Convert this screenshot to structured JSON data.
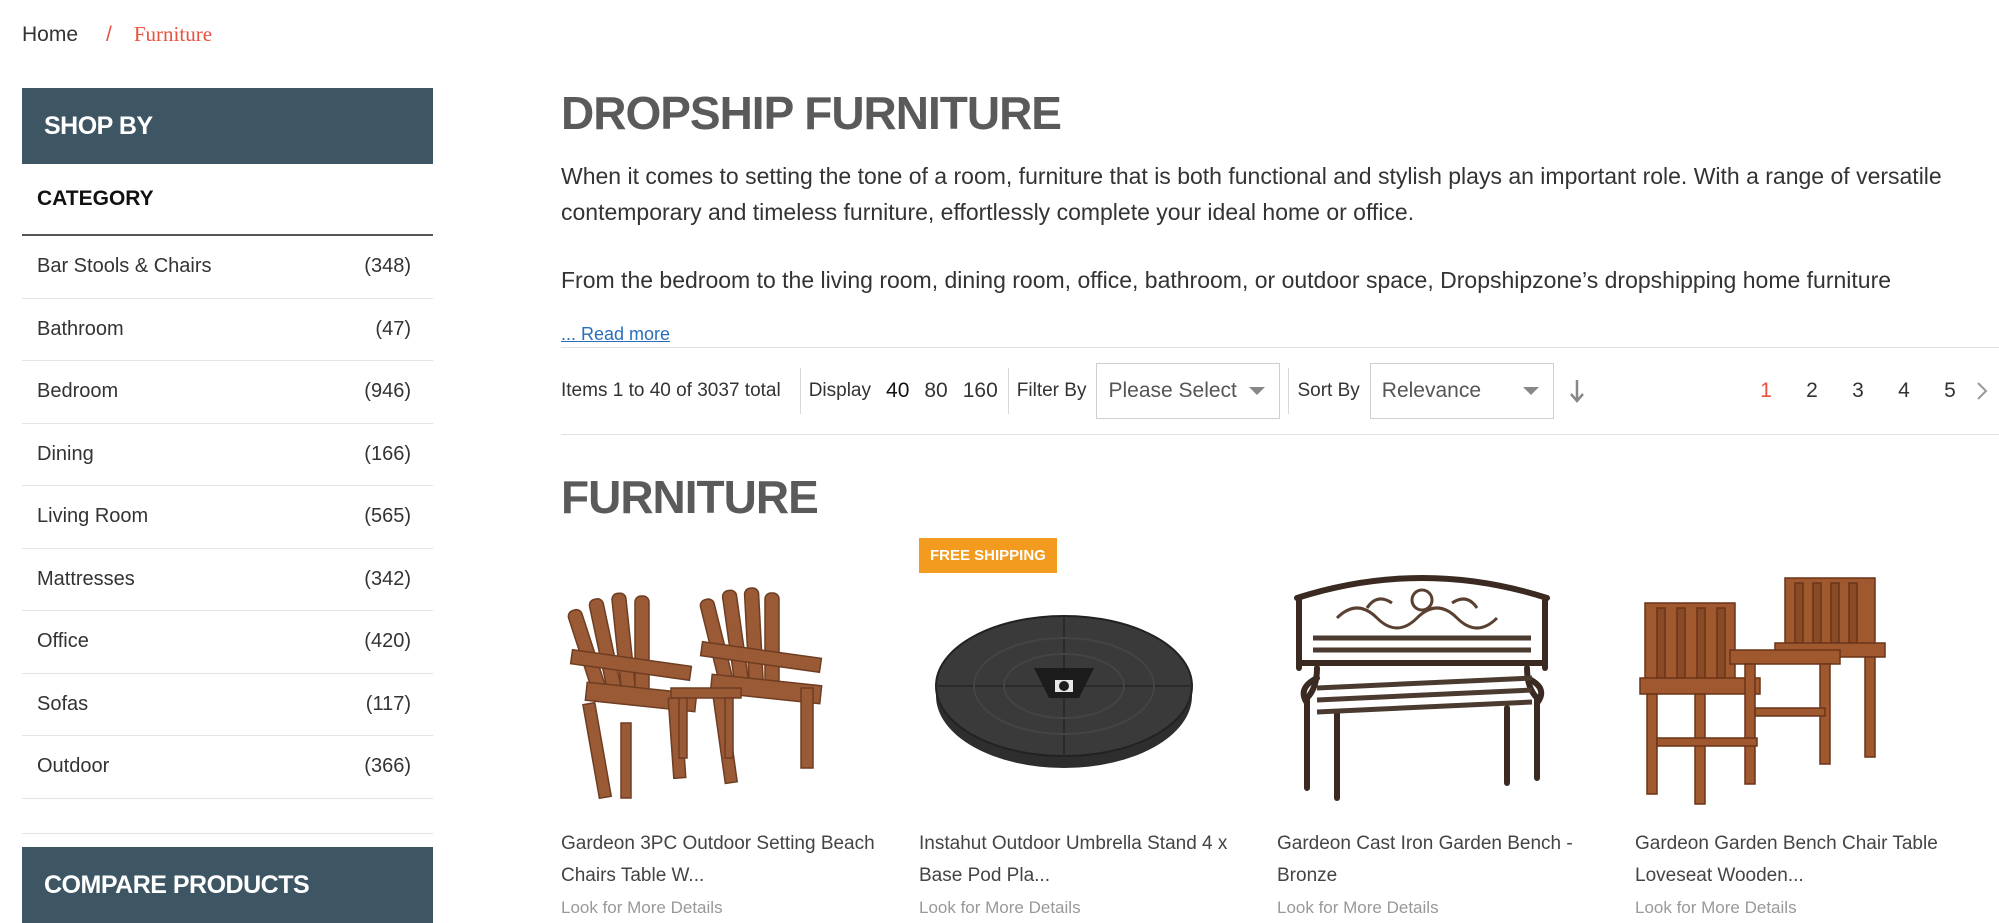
{
  "breadcrumb": {
    "home": "Home",
    "separator": "/",
    "current": "Furniture"
  },
  "sidebar": {
    "shop_by": "SHOP BY",
    "category_heading": "CATEGORY",
    "items": [
      {
        "label": "Bar Stools & Chairs",
        "count": "(348)"
      },
      {
        "label": "Bathroom",
        "count": "(47)"
      },
      {
        "label": "Bedroom",
        "count": "(946)"
      },
      {
        "label": "Dining",
        "count": "(166)"
      },
      {
        "label": "Living Room",
        "count": "(565)"
      },
      {
        "label": "Mattresses",
        "count": "(342)"
      },
      {
        "label": "Office",
        "count": "(420)"
      },
      {
        "label": "Sofas",
        "count": "(117)"
      },
      {
        "label": "Outdoor",
        "count": "(366)"
      }
    ],
    "compare_title": "COMPARE PRODUCTS"
  },
  "main": {
    "title": "DROPSHIP FURNITURE",
    "desc_1": "When it comes to setting the tone of a room, furniture that is both functional and stylish plays an important role. With a range of versatile contemporary and timeless furniture, effortlessly complete your ideal home or office.",
    "desc_2": "From the bedroom to the living room, dining room, office, bathroom, or outdoor space, Dropshipzone’s dropshipping home furniture",
    "read_more": "... Read more",
    "section_title": "FURNITURE"
  },
  "toolbar": {
    "items_text": "Items 1 to 40 of 3037 total",
    "display_label": "Display",
    "display_options": [
      "40",
      "80",
      "160"
    ],
    "filter_label": "Filter By",
    "filter_value": "Please Select",
    "sort_label": "Sort By",
    "sort_value": "Relevance",
    "pages": [
      "1",
      "2",
      "3",
      "4",
      "5"
    ],
    "current_page": "1"
  },
  "products": [
    {
      "name": "Gardeon 3PC Outdoor Setting Beach Chairs Table W...",
      "more": "Look for More Details",
      "badge": ""
    },
    {
      "name": "Instahut Outdoor Umbrella Stand 4 x Base Pod Pla...",
      "more": "Look for More Details",
      "badge": "FREE SHIPPING"
    },
    {
      "name": "Gardeon Cast Iron Garden Bench - Bronze",
      "more": "Look for More Details",
      "badge": ""
    },
    {
      "name": "Gardeon Garden Bench Chair Table Loveseat Wooden...",
      "more": "Look for More Details",
      "badge": ""
    }
  ],
  "colors": {
    "accent": "#e8523f",
    "sidebar_header": "#3e5664",
    "badge": "#f39b1e",
    "link": "#2a6ebb"
  }
}
